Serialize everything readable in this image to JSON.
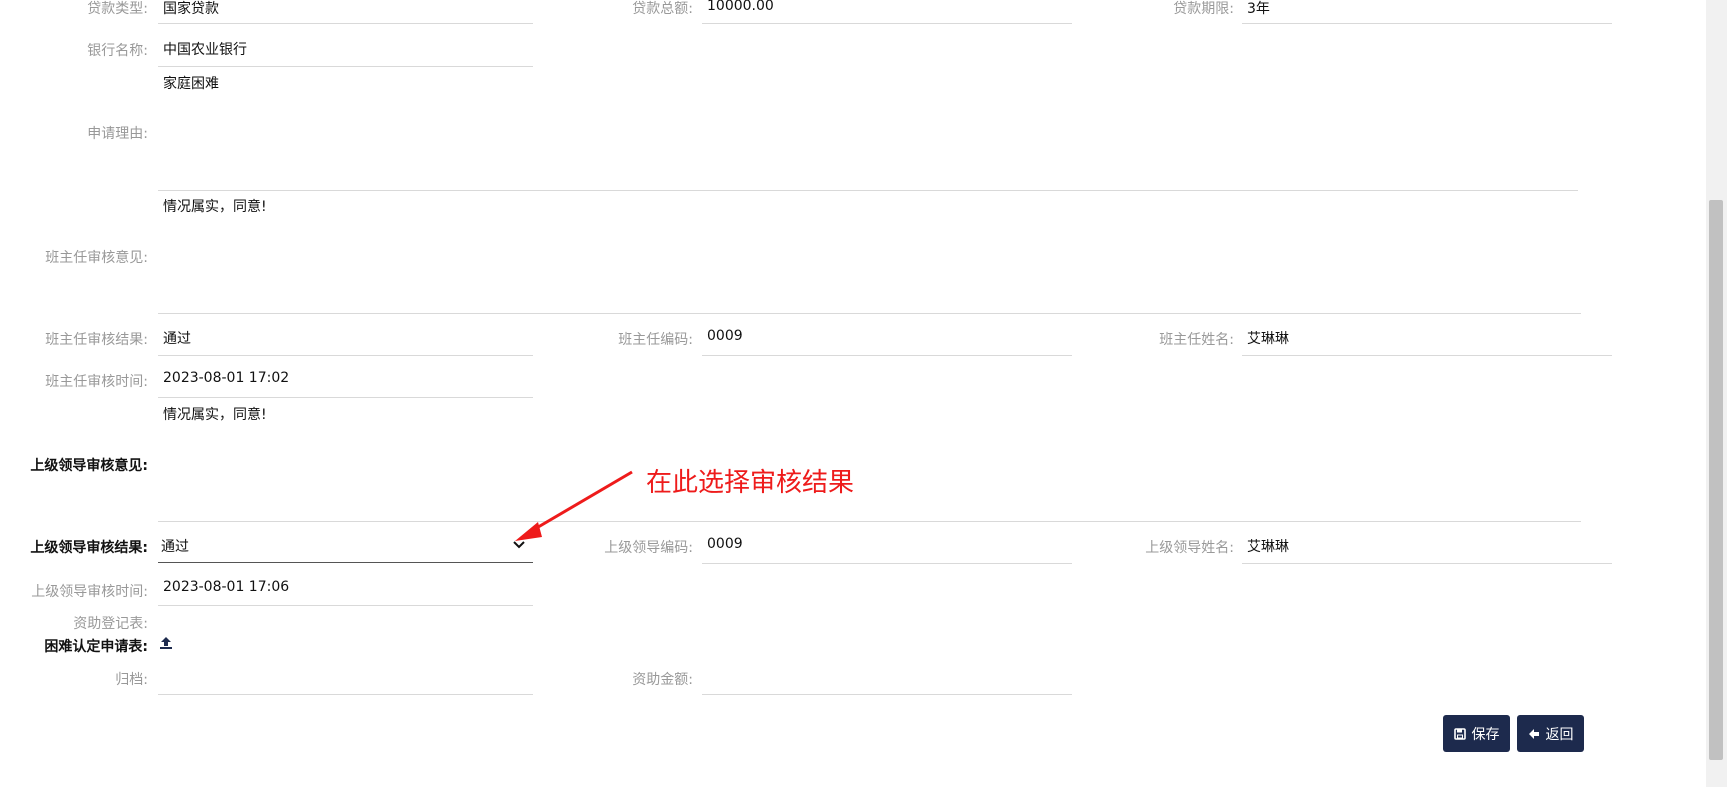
{
  "form": {
    "loan_type": {
      "label": "贷款类型:",
      "value": "国家贷款"
    },
    "loan_total": {
      "label": "贷款总额:",
      "value": "10000.00"
    },
    "loan_term": {
      "label": "贷款期限:",
      "value": "3年"
    },
    "bank_name": {
      "label": "银行名称:",
      "value": "中国农业银行"
    },
    "apply_reason": {
      "label": "申请理由:",
      "value": "家庭困难"
    },
    "teacher_opinion": {
      "label": "班主任审核意见:",
      "value": "情况属实，同意!"
    },
    "teacher_result": {
      "label": "班主任审核结果:",
      "value": "通过"
    },
    "teacher_code": {
      "label": "班主任编码:",
      "value": "0009"
    },
    "teacher_name": {
      "label": "班主任姓名:",
      "value": "艾琳琳"
    },
    "teacher_time": {
      "label": "班主任审核时间:",
      "value": "2023-08-01 17:02"
    },
    "leader_opinion": {
      "label": "上级领导审核意见:",
      "value": "情况属实，同意!"
    },
    "leader_result": {
      "label": "上级领导审核结果:",
      "value": "通过"
    },
    "leader_code": {
      "label": "上级领导编码:",
      "value": "0009"
    },
    "leader_name": {
      "label": "上级领导姓名:",
      "value": "艾琳琳"
    },
    "leader_time": {
      "label": "上级领导审核时间:",
      "value": "2023-08-01 17:06"
    },
    "aid_register": {
      "label": "资助登记表:"
    },
    "difficulty_form": {
      "label": "困难认定申请表:"
    },
    "archive": {
      "label": "归档:"
    },
    "aid_amount": {
      "label": "资助金额:"
    }
  },
  "annotation": {
    "text": "在此选择审核结果",
    "color": "#ee1b1b"
  },
  "buttons": {
    "save": "保存",
    "back": "返回"
  },
  "colors": {
    "button_bg": "#1d2a4d",
    "label_gray": "#999999"
  },
  "icons": {
    "upload": "upload-icon",
    "save": "floppy-icon",
    "back": "arrow-left-icon",
    "dropdown": "chevron-down-icon"
  }
}
